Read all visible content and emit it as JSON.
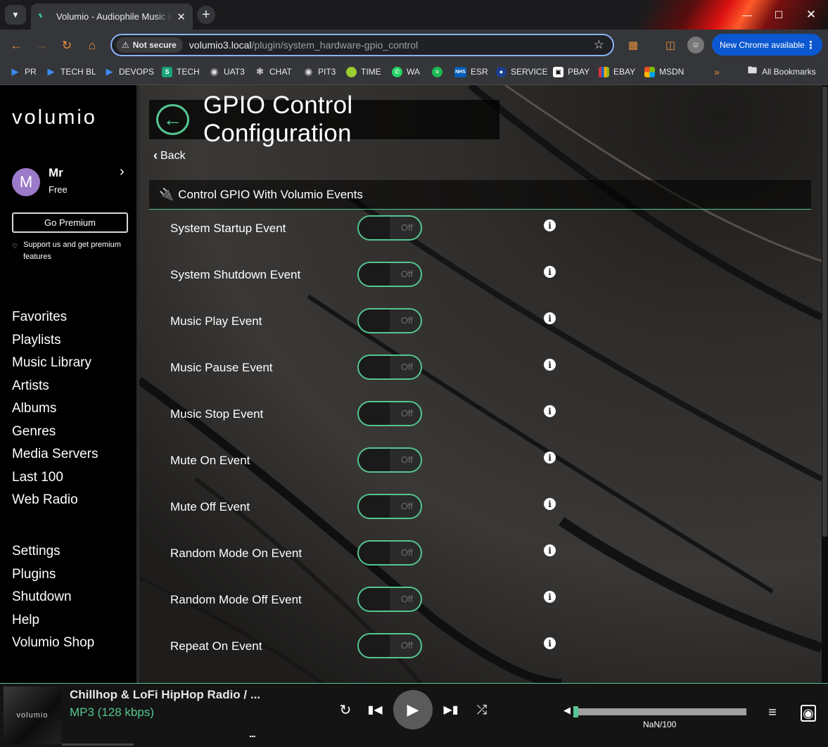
{
  "browser": {
    "tab_title": "Volumio - Audiophile Music Player",
    "security_chip": "Not secure",
    "url_host": "volumio3.local",
    "url_path": "/plugin/system_hardware-gpio_control",
    "new_chrome": "New Chrome available",
    "bookmarks": [
      {
        "label": "PR",
        "icon": "azure-devops-icon"
      },
      {
        "label": "TECH BL",
        "icon": "azure-devops-icon"
      },
      {
        "label": "DEVOPS",
        "icon": "azure-devops-icon"
      },
      {
        "label": "TECH",
        "icon": "s-icon"
      },
      {
        "label": "UAT3",
        "icon": "globe-icon"
      },
      {
        "label": "CHAT",
        "icon": "openai-icon"
      },
      {
        "label": "PIT3",
        "icon": "globe-icon"
      },
      {
        "label": "TIME",
        "icon": "lime-icon"
      },
      {
        "label": "WA",
        "icon": "whatsapp-icon"
      },
      {
        "label": "",
        "icon": "spotify-icon"
      },
      {
        "label": "ESR",
        "icon": "nhs-icon"
      },
      {
        "label": "SERVICE",
        "icon": "service-icon"
      },
      {
        "label": "PBAY",
        "icon": "pbay-icon"
      },
      {
        "label": "EBAY",
        "icon": "ebay-icon"
      },
      {
        "label": "MSDN",
        "icon": "microsoft-icon"
      }
    ],
    "all_bookmarks": "All Bookmarks",
    "colors": {
      "accent": "#8ab4f8",
      "update_button": "#0b57d0"
    }
  },
  "sidebar": {
    "logo": "volumio",
    "user": {
      "initial": "M",
      "name": "Mr",
      "plan": "Free"
    },
    "go_premium": "Go Premium",
    "support_text": "Support us and get premium features",
    "menu_primary": [
      "Favorites",
      "Playlists",
      "Music Library",
      "Artists",
      "Albums",
      "Genres",
      "Media Servers",
      "Last 100",
      "Web Radio"
    ],
    "menu_secondary": [
      "Settings",
      "Plugins",
      "Shutdown",
      "Help",
      "Volumio Shop"
    ]
  },
  "page": {
    "title": "GPIO Control Configuration",
    "back_label": "Back",
    "section_title": "Control GPIO With Volumio Events",
    "toggle_off_label": "Off",
    "events": [
      {
        "label": "System Startup Event",
        "state": "Off"
      },
      {
        "label": "System Shutdown Event",
        "state": "Off"
      },
      {
        "label": "Music Play Event",
        "state": "Off"
      },
      {
        "label": "Music Pause Event",
        "state": "Off"
      },
      {
        "label": "Music Stop Event",
        "state": "Off"
      },
      {
        "label": "Mute On Event",
        "state": "Off"
      },
      {
        "label": "Mute Off Event",
        "state": "Off"
      },
      {
        "label": "Random Mode On Event",
        "state": "Off"
      },
      {
        "label": "Random Mode Off Event",
        "state": "Off"
      },
      {
        "label": "Repeat On Event",
        "state": "Off"
      }
    ],
    "colors": {
      "accent": "#54c690"
    }
  },
  "player": {
    "album_art_text": "volumio",
    "track_title": "Chillhop & LoFi HipHop Radio / ...",
    "format": "MP3 (128 kbps)",
    "more": "...",
    "volume_text": "NaN/100",
    "volume_level": 0.03
  }
}
